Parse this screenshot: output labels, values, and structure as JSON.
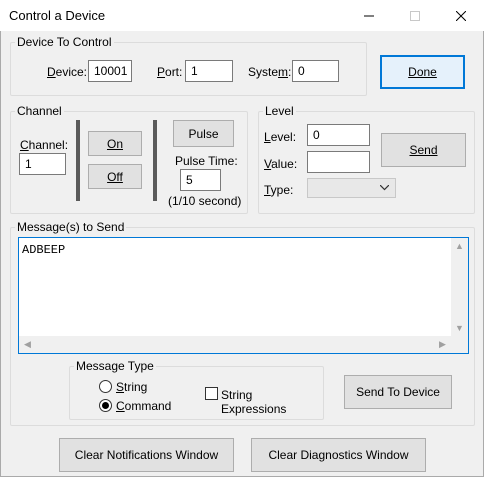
{
  "window": {
    "title": "Control a Device",
    "controls": [
      "minimize-icon",
      "maximize-icon",
      "close-icon"
    ]
  },
  "device_group": {
    "label": "Device To Control",
    "device_label": "Device:",
    "device_value": "10001",
    "port_label": "Port:",
    "port_value": "1",
    "system_label": "System:",
    "system_value": "0"
  },
  "done_button": "Done",
  "channel_group": {
    "label": "Channel",
    "channel_label": "Channel:",
    "channel_value": "1",
    "on_button": "On",
    "off_button": "Off",
    "pulse_button": "Pulse",
    "pulse_time_label": "Pulse Time:",
    "pulse_time_value": "5",
    "pulse_units": "(1/10 second)"
  },
  "level_group": {
    "label": "Level",
    "level_label": "Level:",
    "level_value": "0",
    "value_label": "Value:",
    "value_value": "",
    "type_label": "Type:",
    "type_value": "",
    "send_button": "Send"
  },
  "messages": {
    "label": "Message(s) to Send",
    "text": "ADBEEP"
  },
  "message_type": {
    "label": "Message Type",
    "string_option": "String",
    "command_option": "Command",
    "selected": "Command",
    "string_expressions_label": "String Expressions",
    "string_expressions_checked": false
  },
  "send_to_device_button": "Send To Device",
  "clear_notifications_button": "Clear Notifications Window",
  "clear_diagnostics_button": "Clear Diagnostics Window",
  "colors": {
    "accent": "#0078d7",
    "window_bg": "#f0f0f0",
    "button_bg": "#e1e1e1"
  }
}
